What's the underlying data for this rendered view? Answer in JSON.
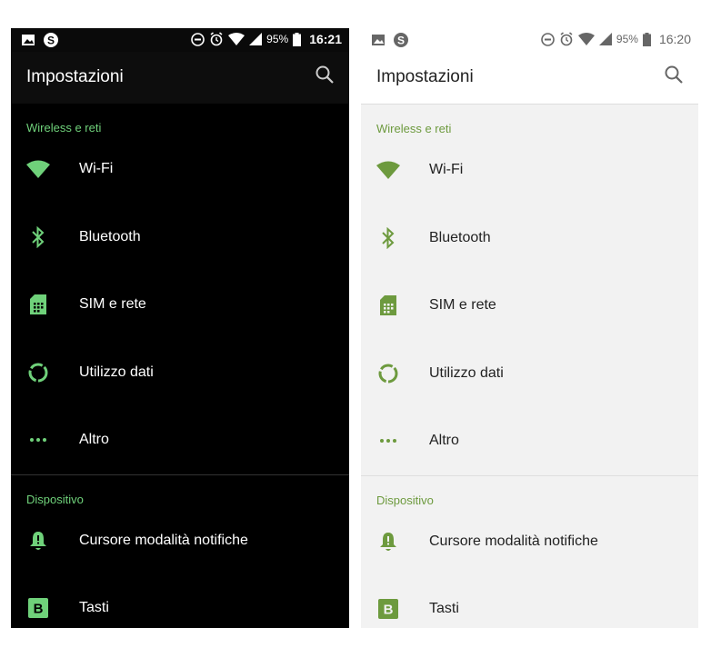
{
  "colors": {
    "dark_accent": "#6fd17a",
    "light_accent": "#6d9a3e",
    "dark_bg": "#000000",
    "light_bg": "#f2f2f2"
  },
  "dark": {
    "status": {
      "battery": "95%",
      "time": "16:21"
    },
    "title": "Impostazioni",
    "sections": [
      {
        "header": "Wireless e reti",
        "items": [
          "Wi-Fi",
          "Bluetooth",
          "SIM e rete",
          "Utilizzo dati",
          "Altro"
        ]
      },
      {
        "header": "Dispositivo",
        "items": [
          "Cursore modalità notifiche",
          "Tasti"
        ]
      }
    ]
  },
  "light": {
    "status": {
      "battery": "95%",
      "time": "16:20"
    },
    "title": "Impostazioni",
    "sections": [
      {
        "header": "Wireless e reti",
        "items": [
          "Wi-Fi",
          "Bluetooth",
          "SIM e rete",
          "Utilizzo dati",
          "Altro"
        ]
      },
      {
        "header": "Dispositivo",
        "items": [
          "Cursore modalità notifiche",
          "Tasti"
        ]
      }
    ]
  },
  "icons": [
    "image-icon",
    "skype-icon",
    "dnd-icon",
    "alarm-icon",
    "wifi-signal-icon",
    "cell-signal-icon",
    "battery-icon",
    "search-icon",
    "wifi-icon",
    "bluetooth-icon",
    "sim-icon",
    "data-usage-icon",
    "more-icon",
    "notification-bell-icon",
    "buttons-icon"
  ]
}
